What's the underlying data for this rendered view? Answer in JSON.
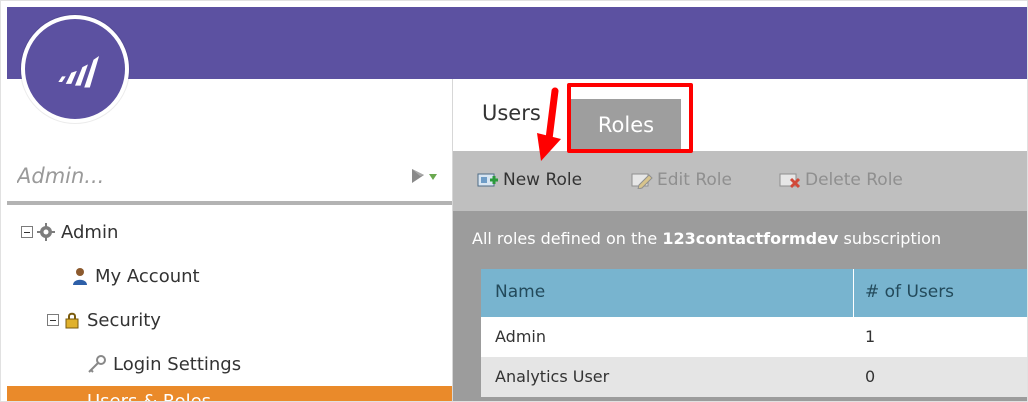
{
  "search": {
    "placeholder": "Admin..."
  },
  "tree": {
    "admin": "Admin",
    "my_account": "My Account",
    "security": "Security",
    "login_settings": "Login Settings",
    "users_roles": "Users & Roles"
  },
  "tabs": {
    "users": "Users",
    "roles": "Roles"
  },
  "toolbar": {
    "new_role": "New Role",
    "edit_role": "Edit Role",
    "delete_role": "Delete Role"
  },
  "subtitle": {
    "prefix": "All roles defined on the ",
    "subscription": "123contactformdev",
    "suffix": " subscription"
  },
  "table": {
    "headers": {
      "name": "Name",
      "users": "# of Users"
    },
    "rows": [
      {
        "name": "Admin",
        "users": "1"
      },
      {
        "name": "Analytics User",
        "users": "0"
      }
    ]
  },
  "colors": {
    "topbar": "#5c51a1",
    "active_nav": "#ea8a2a",
    "table_header": "#78b4cf",
    "highlight": "#ff0000"
  }
}
